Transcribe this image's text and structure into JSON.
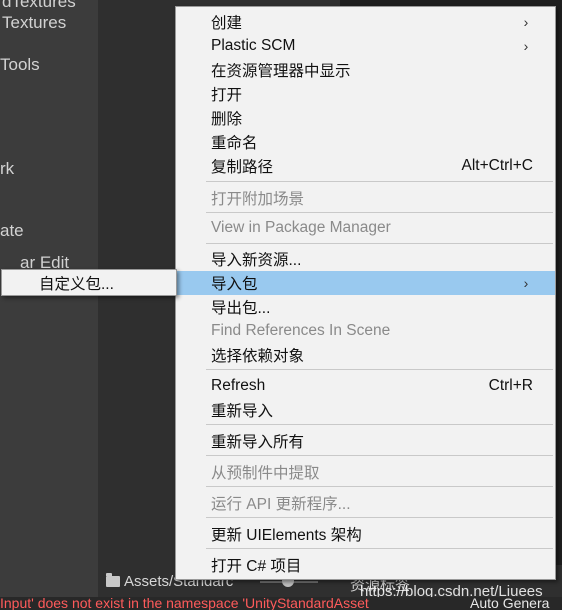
{
  "left_panel": {
    "items": [
      "dTextures",
      "Textures",
      "Tools",
      "rk",
      "ate",
      "ar Edit"
    ]
  },
  "bottom": {
    "folder_path": "Assets/Standarc",
    "right_label": "资源标签",
    "watermark": "https://blog.csdn.net/Liuees"
  },
  "status_bar": {
    "error_text": "Input' does not exist in the namespace 'UnityStandardAsset",
    "right_text": "Auto Genera"
  },
  "context_menu": {
    "items": [
      {
        "label": "创建",
        "arrow": "›"
      },
      {
        "label": "Plastic SCM",
        "arrow": "›"
      },
      {
        "label": "在资源管理器中显示"
      },
      {
        "label": "打开"
      },
      {
        "label": "删除"
      },
      {
        "label": "重命名"
      },
      {
        "label": "复制路径",
        "shortcut": "Alt+Ctrl+C"
      },
      {
        "label": "打开附加场景",
        "disabled": true
      },
      {
        "label": "View in Package Manager",
        "disabled": true
      },
      {
        "label": "导入新资源..."
      },
      {
        "label": "导入包",
        "arrow": "›",
        "highlighted": true
      },
      {
        "label": "导出包..."
      },
      {
        "label": "Find References In Scene",
        "disabled": true
      },
      {
        "label": "选择依赖对象"
      },
      {
        "label": "Refresh",
        "shortcut": "Ctrl+R"
      },
      {
        "label": "重新导入"
      },
      {
        "label": "重新导入所有"
      },
      {
        "label": "从预制件中提取",
        "disabled": true
      },
      {
        "label": "运行 API 更新程序...",
        "disabled": true
      },
      {
        "label": "更新 UIElements 架构"
      },
      {
        "label": "打开 C# 项目"
      }
    ]
  },
  "submenu": {
    "items": [
      {
        "label": "自定义包..."
      }
    ]
  }
}
